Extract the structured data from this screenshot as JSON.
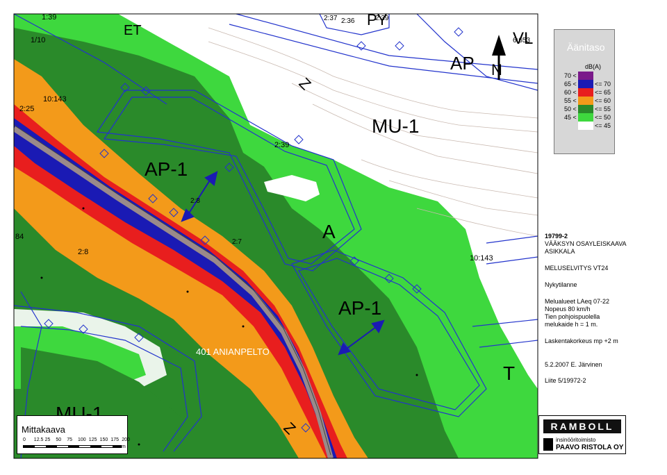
{
  "legend": {
    "title": "Äänitaso",
    "unit": "dB(A)",
    "rows": [
      {
        "low": "70 <",
        "high": "",
        "color": "#7a1a8a"
      },
      {
        "low": "65 <",
        "high": "<= 70",
        "color": "#1a1ab4"
      },
      {
        "low": "60 <",
        "high": "<= 65",
        "color": "#e81e1e"
      },
      {
        "low": "55 <",
        "high": "<= 60",
        "color": "#f39a1a"
      },
      {
        "low": "50 <",
        "high": "<= 55",
        "color": "#2a8a2a"
      },
      {
        "low": "45 <",
        "high": "<= 50",
        "color": "#3ed83e"
      },
      {
        "low": "",
        "high": "<= 45",
        "color": "#ffffff"
      }
    ]
  },
  "info": {
    "code": "19799-2",
    "title1": "VÄÄKSYN OSAYLEISKAAVA",
    "title2": "ASIKKALA",
    "study": "MELUSELVITYS VT24",
    "situation": "Nykytilanne",
    "line1": "Melualueet LAeq 07-22",
    "line2": "Nopeus 80 km/h",
    "line3": "Tien pohjoispuolella",
    "line4": "melukaide h = 1 m.",
    "height": "Laskentakorkeus mp +2 m",
    "date": "5.2.2007 E. Järvinen",
    "appendix": "Liite 5/19972-2"
  },
  "scale": {
    "title": "Mittakaava",
    "ticks": [
      "0",
      "12.5",
      "25",
      "50",
      "75",
      "100",
      "125",
      "150",
      "175",
      "200"
    ],
    "unit": "m"
  },
  "logo": {
    "company": "RAMBOLL",
    "sub1": "insinööritoimisto",
    "sub2": "PAAVO RISTOLA OY"
  },
  "map_labels": {
    "et": "ET",
    "py": "PY",
    "vl": "VL",
    "ap": "AP",
    "north": "N",
    "mu1_top": "MU-1",
    "ap1_left": "AP-1",
    "ap1_right": "AP-1",
    "a": "A",
    "t": "T",
    "mu1_bottom": "MU-1",
    "road_name": "401 ANIANPELTO",
    "z_top": "Z",
    "z_bottom": "Z",
    "r_139": "1:39",
    "r_110": "1/10",
    "r_10143_left": "10:143",
    "r_225": "2:25",
    "r_2361": "2:36",
    "r_237": "2:37",
    "r_239a": "2:39",
    "r_6653": "6:653",
    "r_239b": "2:39",
    "r_28a": "2:8",
    "r_27": "2:7",
    "r_28b": "2:8",
    "r_84": "84",
    "r_10143_right": "10:143"
  },
  "colors": {
    "white_zone": "#ffffff",
    "lt_green": "#3ed83e",
    "dk_green": "#2a8a2a",
    "orange": "#f39a1a",
    "red": "#e81e1e",
    "blue": "#1a1ab4",
    "purple": "#7a1a8a",
    "road": "#9a8a8a",
    "plan_lines": "#2233cc"
  }
}
